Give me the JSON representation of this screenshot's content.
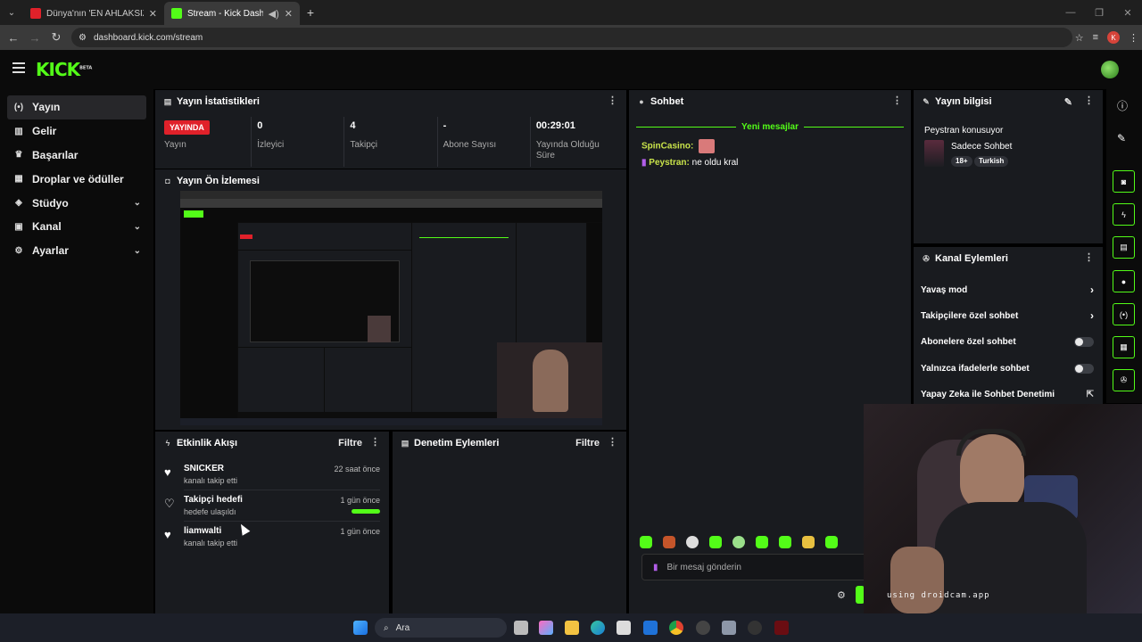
{
  "browser": {
    "tabs": [
      {
        "title": "Dünya'nın 'EN AHLAKSIZ' Biline",
        "favicon_color": "#e0212a"
      },
      {
        "title": "Stream - Kick Dashboard",
        "favicon_color": "#53fc18"
      }
    ],
    "url": "dashboard.kick.com/stream",
    "profile_initial": "K"
  },
  "header": {
    "logo": "KICK",
    "logo_badge": "BETA"
  },
  "sidebar": {
    "items": [
      {
        "label": "Yayın",
        "icon": "broadcast-icon",
        "active": true
      },
      {
        "label": "Gelir",
        "icon": "revenue-icon"
      },
      {
        "label": "Başarılar",
        "icon": "trophy-icon"
      },
      {
        "label": "Droplar ve ödüller",
        "icon": "gift-icon"
      },
      {
        "label": "Stüdyo",
        "icon": "studio-icon",
        "expandable": true
      },
      {
        "label": "Kanal",
        "icon": "channel-icon",
        "expandable": true
      },
      {
        "label": "Ayarlar",
        "icon": "gear-icon",
        "expandable": true
      }
    ]
  },
  "stats": {
    "title": "Yayın İstatistikleri",
    "items": [
      {
        "value": "YAYINDA",
        "label": "Yayın"
      },
      {
        "value": "0",
        "label": "İzleyici"
      },
      {
        "value": "4",
        "label": "Takipçi"
      },
      {
        "value": "-",
        "label": "Abone Sayısı"
      },
      {
        "value": "00:29:01",
        "label": "Yayında Olduğu Süre"
      }
    ]
  },
  "preview": {
    "title": "Yayın Ön İzlemesi"
  },
  "activity": {
    "title": "Etkinlik Akışı",
    "filter": "Filtre",
    "items": [
      {
        "name": "SNICKER",
        "sub": "kanalı takip etti",
        "time": "22 saat önce"
      },
      {
        "name": "Takipçi hedefi",
        "sub": "hedefe ulaşıldı",
        "time": "1 gün önce",
        "progress": 1.0
      },
      {
        "name": "liamwalti",
        "sub": "kanalı takip etti",
        "time": "1 gün önce"
      }
    ]
  },
  "moderation": {
    "title": "Denetim Eylemleri",
    "filter": "Filtre"
  },
  "chat": {
    "title": "Sohbet",
    "new_messages": "Yeni mesajlar",
    "messages": [
      {
        "user": "SpinCasino:",
        "text": "",
        "color": "#c9e34a"
      },
      {
        "user": "Peystran:",
        "text": "ne oldu kral",
        "color": "#c9e34a"
      }
    ],
    "input_placeholder": "Bir mesaj gönderin"
  },
  "stream_info": {
    "title": "Yayın bilgisi",
    "stream_title": "Peystran konusuyor",
    "category": "Sadece Sohbet",
    "tags": [
      "18+",
      "Turkish"
    ]
  },
  "channel_actions": {
    "title": "Kanal Eylemleri",
    "items": [
      {
        "label": "Yavaş mod",
        "control": "chevron"
      },
      {
        "label": "Takipçilere özel sohbet",
        "control": "chevron"
      },
      {
        "label": "Abonelere özel sohbet",
        "control": "toggle",
        "on": false
      },
      {
        "label": "Yalnızca ifadelerle sohbet",
        "control": "toggle",
        "on": false
      },
      {
        "label": "Yapay Zeka ile Sohbet Denetimi",
        "control": "external"
      }
    ]
  },
  "webcam": {
    "overlay": "using droidcam.app"
  },
  "taskbar": {
    "search": "Ara"
  },
  "colors": {
    "accent": "#53fc18",
    "live": "#e0212a",
    "panel": "#191b1f"
  }
}
